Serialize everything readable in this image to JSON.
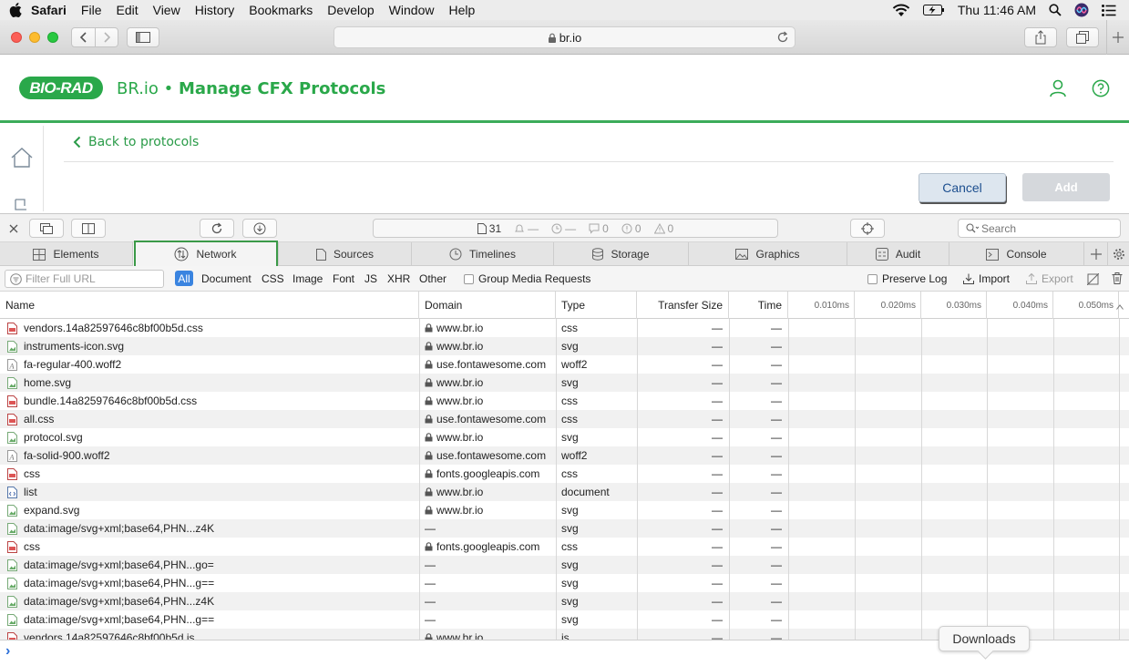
{
  "menubar": {
    "app": "Safari",
    "items": [
      "File",
      "Edit",
      "View",
      "History",
      "Bookmarks",
      "Develop",
      "Window",
      "Help"
    ],
    "clock": "Thu 11:46 AM"
  },
  "browser": {
    "url": "br.io"
  },
  "page": {
    "logo": "BIO-RAD",
    "title_prefix": "BR.io • ",
    "title_main": "Manage CFX Protocols",
    "back_link": "Back to protocols",
    "cancel_label": "Cancel",
    "add_label": "Add"
  },
  "inspector": {
    "resource_count": "31",
    "dash1": "—",
    "dash2": "—",
    "messages_count": "0",
    "errors_count": "0",
    "warnings_count": "0",
    "search_placeholder": "Search",
    "tabs": [
      "Elements",
      "Network",
      "Sources",
      "Timelines",
      "Storage",
      "Graphics",
      "Audit",
      "Console"
    ],
    "active_tab": "Network",
    "filter_placeholder": "Filter Full URL",
    "type_filters": [
      "All",
      "Document",
      "CSS",
      "Image",
      "Font",
      "JS",
      "XHR",
      "Other"
    ],
    "group_media": "Group Media Requests",
    "preserve_log": "Preserve Log",
    "import_label": "Import",
    "export_label": "Export",
    "columns": {
      "name": "Name",
      "domain": "Domain",
      "type": "Type",
      "transfer": "Transfer Size",
      "time": "Time"
    },
    "timeline_ticks": [
      "0.010ms",
      "0.020ms",
      "0.030ms",
      "0.040ms",
      "0.050ms"
    ],
    "rows": [
      {
        "name": "vendors.14a82597646c8bf00b5d.css",
        "icon": "css",
        "domain": "www.br.io",
        "lock": true,
        "type": "css",
        "size": "—",
        "time": "—"
      },
      {
        "name": "instruments-icon.svg",
        "icon": "img",
        "domain": "www.br.io",
        "lock": true,
        "type": "svg",
        "size": "—",
        "time": "—"
      },
      {
        "name": "fa-regular-400.woff2",
        "icon": "font",
        "domain": "use.fontawesome.com",
        "lock": true,
        "type": "woff2",
        "size": "—",
        "time": "—"
      },
      {
        "name": "home.svg",
        "icon": "img",
        "domain": "www.br.io",
        "lock": true,
        "type": "svg",
        "size": "—",
        "time": "—"
      },
      {
        "name": "bundle.14a82597646c8bf00b5d.css",
        "icon": "css",
        "domain": "www.br.io",
        "lock": true,
        "type": "css",
        "size": "—",
        "time": "—"
      },
      {
        "name": "all.css",
        "icon": "css",
        "domain": "use.fontawesome.com",
        "lock": true,
        "type": "css",
        "size": "—",
        "time": "—"
      },
      {
        "name": "protocol.svg",
        "icon": "img",
        "domain": "www.br.io",
        "lock": true,
        "type": "svg",
        "size": "—",
        "time": "—"
      },
      {
        "name": "fa-solid-900.woff2",
        "icon": "font",
        "domain": "use.fontawesome.com",
        "lock": true,
        "type": "woff2",
        "size": "—",
        "time": "—"
      },
      {
        "name": "css",
        "icon": "css",
        "domain": "fonts.googleapis.com",
        "lock": true,
        "type": "css",
        "size": "—",
        "time": "—"
      },
      {
        "name": "list",
        "icon": "doc",
        "domain": "www.br.io",
        "lock": true,
        "type": "document",
        "size": "—",
        "time": "—"
      },
      {
        "name": "expand.svg",
        "icon": "img",
        "domain": "www.br.io",
        "lock": true,
        "type": "svg",
        "size": "—",
        "time": "—"
      },
      {
        "name": "data:image/svg+xml;base64,PHN...z4K",
        "icon": "img",
        "domain": "—",
        "lock": false,
        "type": "svg",
        "size": "—",
        "time": "—"
      },
      {
        "name": "css",
        "icon": "css",
        "domain": "fonts.googleapis.com",
        "lock": true,
        "type": "css",
        "size": "—",
        "time": "—"
      },
      {
        "name": "data:image/svg+xml;base64,PHN...go=",
        "icon": "img",
        "domain": "—",
        "lock": false,
        "type": "svg",
        "size": "—",
        "time": "—"
      },
      {
        "name": "data:image/svg+xml;base64,PHN...g==",
        "icon": "img",
        "domain": "—",
        "lock": false,
        "type": "svg",
        "size": "—",
        "time": "—"
      },
      {
        "name": "data:image/svg+xml;base64,PHN...z4K",
        "icon": "img",
        "domain": "—",
        "lock": false,
        "type": "svg",
        "size": "—",
        "time": "—"
      },
      {
        "name": "data:image/svg+xml;base64,PHN...g==",
        "icon": "img",
        "domain": "—",
        "lock": false,
        "type": "svg",
        "size": "—",
        "time": "—"
      },
      {
        "name": "vendors.14a82597646c8bf00b5d.js",
        "icon": "js",
        "domain": "www.br.io",
        "lock": true,
        "type": "js",
        "size": "—",
        "time": "—"
      }
    ],
    "console_prompt": "›"
  },
  "downloads_tooltip": "Downloads",
  "colors": {
    "brand_green": "#2aa84a",
    "highlight_green": "#3b9a48",
    "filter_active": "#3a84e0",
    "cancel_text": "#1d4f8f"
  }
}
